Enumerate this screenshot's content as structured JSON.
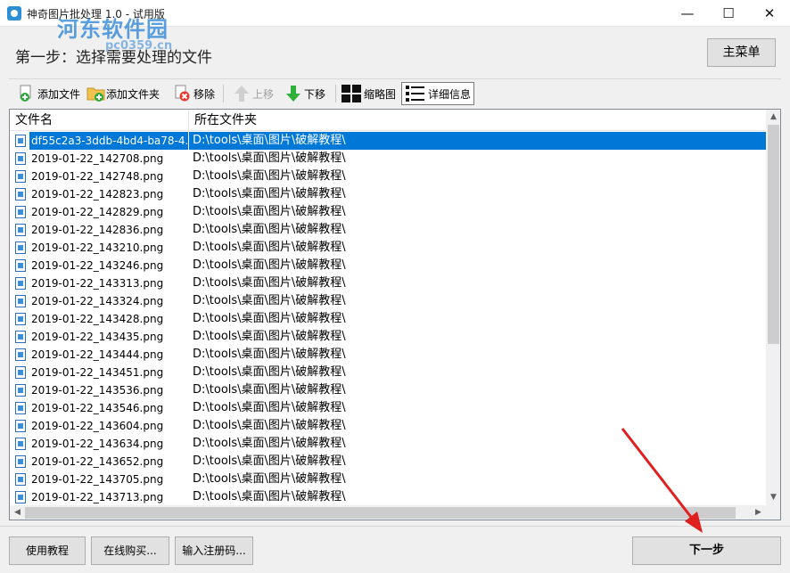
{
  "window": {
    "title": "神奇图片批处理 1.0 - 试用版",
    "minimize": "—",
    "maximize": "☐",
    "close": "✕"
  },
  "watermark": {
    "name": "河东软件园",
    "url": "pc0359.cn"
  },
  "header": {
    "step_title": "第一步：选择需要处理的文件",
    "main_menu": "主菜单"
  },
  "toolbar": {
    "add_file": "添加文件",
    "add_folder": "添加文件夹",
    "remove": "移除",
    "move_up": "上移",
    "move_down": "下移",
    "thumbnail": "缩略图",
    "details": "详细信息"
  },
  "listview": {
    "columns": [
      "文件名",
      "所在文件夹"
    ],
    "rows": [
      {
        "name": "df55c2a3-3ddb-4bd4-ba78-4...",
        "folder": "D:\\tools\\桌面\\图片\\破解教程\\"
      },
      {
        "name": "2019-01-22_142708.png",
        "folder": "D:\\tools\\桌面\\图片\\破解教程\\"
      },
      {
        "name": "2019-01-22_142748.png",
        "folder": "D:\\tools\\桌面\\图片\\破解教程\\"
      },
      {
        "name": "2019-01-22_142823.png",
        "folder": "D:\\tools\\桌面\\图片\\破解教程\\"
      },
      {
        "name": "2019-01-22_142829.png",
        "folder": "D:\\tools\\桌面\\图片\\破解教程\\"
      },
      {
        "name": "2019-01-22_142836.png",
        "folder": "D:\\tools\\桌面\\图片\\破解教程\\"
      },
      {
        "name": "2019-01-22_143210.png",
        "folder": "D:\\tools\\桌面\\图片\\破解教程\\"
      },
      {
        "name": "2019-01-22_143246.png",
        "folder": "D:\\tools\\桌面\\图片\\破解教程\\"
      },
      {
        "name": "2019-01-22_143313.png",
        "folder": "D:\\tools\\桌面\\图片\\破解教程\\"
      },
      {
        "name": "2019-01-22_143324.png",
        "folder": "D:\\tools\\桌面\\图片\\破解教程\\"
      },
      {
        "name": "2019-01-22_143428.png",
        "folder": "D:\\tools\\桌面\\图片\\破解教程\\"
      },
      {
        "name": "2019-01-22_143435.png",
        "folder": "D:\\tools\\桌面\\图片\\破解教程\\"
      },
      {
        "name": "2019-01-22_143444.png",
        "folder": "D:\\tools\\桌面\\图片\\破解教程\\"
      },
      {
        "name": "2019-01-22_143451.png",
        "folder": "D:\\tools\\桌面\\图片\\破解教程\\"
      },
      {
        "name": "2019-01-22_143536.png",
        "folder": "D:\\tools\\桌面\\图片\\破解教程\\"
      },
      {
        "name": "2019-01-22_143546.png",
        "folder": "D:\\tools\\桌面\\图片\\破解教程\\"
      },
      {
        "name": "2019-01-22_143604.png",
        "folder": "D:\\tools\\桌面\\图片\\破解教程\\"
      },
      {
        "name": "2019-01-22_143634.png",
        "folder": "D:\\tools\\桌面\\图片\\破解教程\\"
      },
      {
        "name": "2019-01-22_143652.png",
        "folder": "D:\\tools\\桌面\\图片\\破解教程\\"
      },
      {
        "name": "2019-01-22_143705.png",
        "folder": "D:\\tools\\桌面\\图片\\破解教程\\"
      },
      {
        "name": "2019-01-22_143713.png",
        "folder": "D:\\tools\\桌面\\图片\\破解教程\\"
      }
    ],
    "selected_index": 0
  },
  "footer": {
    "tutorial": "使用教程",
    "buy_online": "在线购买...",
    "enter_code": "输入注册码...",
    "next_step": "下一步"
  },
  "colors": {
    "selection": "#0078d7",
    "annotation_arrow": "#e02020",
    "watermark": "#2c84d6"
  }
}
